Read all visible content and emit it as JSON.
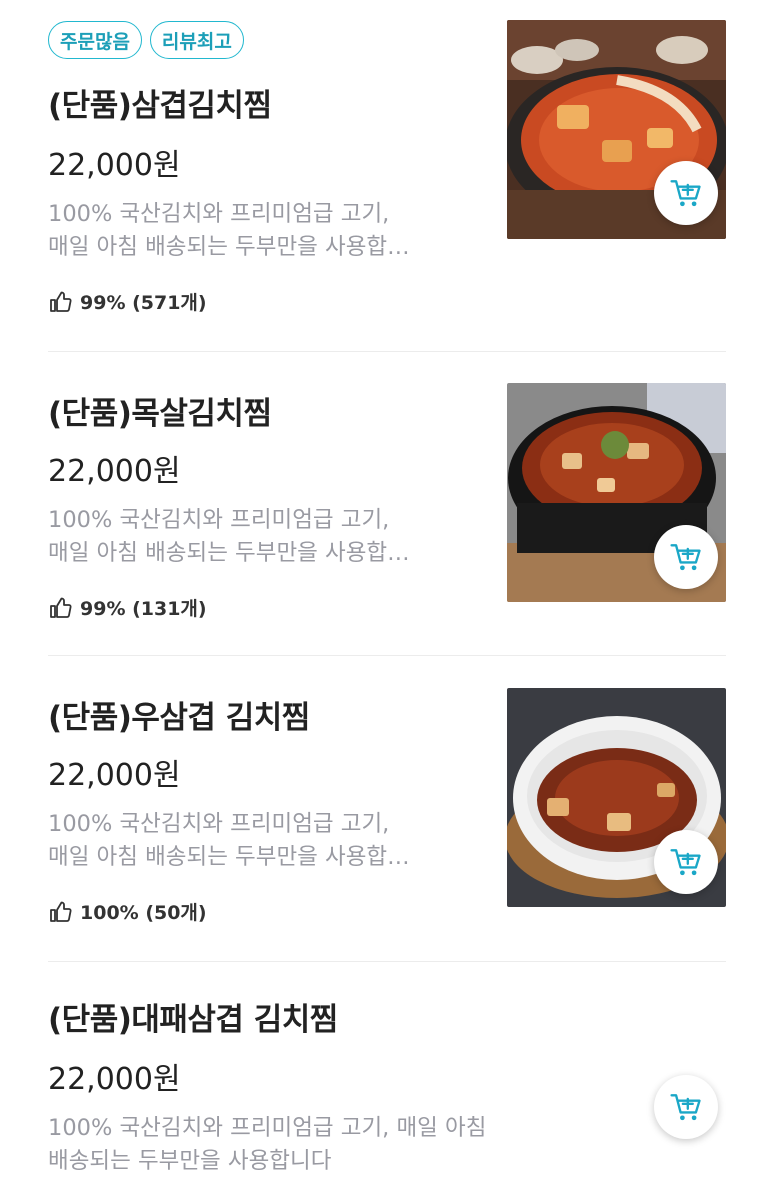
{
  "badges": [
    "주문많음",
    "리뷰최고"
  ],
  "items": [
    {
      "title": "(단품)삼겹김치찜",
      "price": "22,000원",
      "desc_lines": [
        "100% 국산김치와 프리미엄급 고기,",
        "매일 아침 배송되는 두부만을 사용합…"
      ],
      "rating": "99% (571개)"
    },
    {
      "title": "(단품)목살김치찜",
      "price": "22,000원",
      "desc_lines": [
        "100% 국산김치와 프리미엄급 고기,",
        "매일 아침 배송되는 두부만을 사용합…"
      ],
      "rating": "99% (131개)"
    },
    {
      "title": "(단품)우삼겹 김치찜",
      "price": "22,000원",
      "desc_lines": [
        "100% 국산김치와 프리미엄급 고기,",
        "매일 아침 배송되는 두부만을 사용합…"
      ],
      "rating": "100% (50개)"
    },
    {
      "title": "(단품)대패삼겹 김치찜",
      "price": "22,000원",
      "desc_lines": [
        "100% 국산김치와 프리미엄급 고기, 매일 아침",
        "배송되는 두부만을 사용합니다"
      ]
    }
  ],
  "colors": {
    "accent": "#22b8cf",
    "text": "#222222",
    "muted": "#999aa2"
  },
  "icons": {
    "rating": "thumbs-up-icon",
    "cart": "cart-plus-icon"
  }
}
